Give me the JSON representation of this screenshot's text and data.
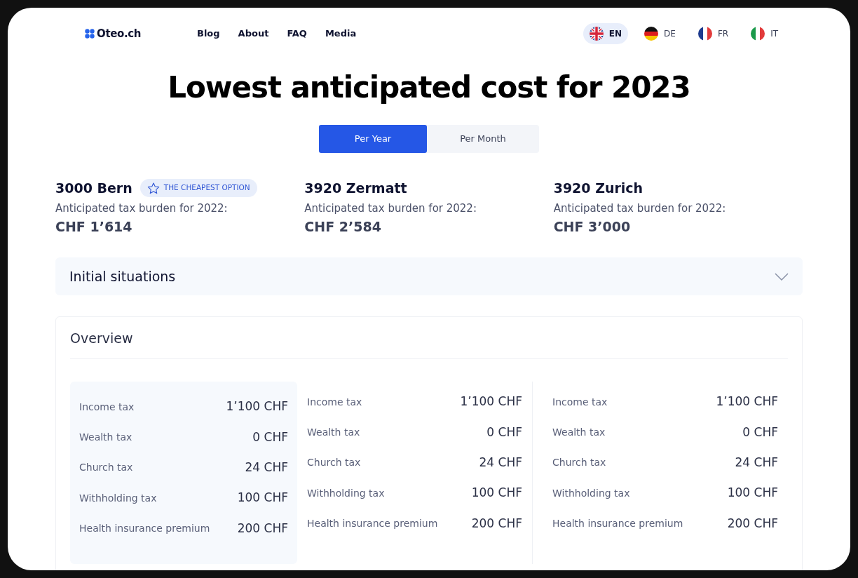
{
  "logo": "Oteo.ch",
  "nav": [
    "Blog",
    "About",
    "FAQ",
    "Media"
  ],
  "languages": [
    {
      "code": "EN",
      "selected": true
    },
    {
      "code": "DE",
      "selected": false
    },
    {
      "code": "FR",
      "selected": false
    },
    {
      "code": "IT",
      "selected": false
    }
  ],
  "heading": "Lowest anticipated cost for 2023",
  "tabs": [
    {
      "label": "Per Year",
      "selected": true
    },
    {
      "label": "Per Month",
      "selected": false
    }
  ],
  "cities": [
    {
      "name": "3000 Bern",
      "badge": "THE CHEAPEST OPTION",
      "caption": "Anticipated tax burden for 2022:",
      "amount": "CHF 1’614"
    },
    {
      "name": "3920 Zermatt",
      "caption": "Anticipated tax burden for 2022:",
      "amount": "CHF 2’584"
    },
    {
      "name": "3920 Zurich",
      "caption": "Anticipated tax burden for 2022:",
      "amount": "CHF 3’000"
    }
  ],
  "accordion": {
    "title": "Initial situations",
    "expanded": false
  },
  "overview": {
    "title": "Overview",
    "columns": [
      {
        "highlighted": true,
        "rows": [
          {
            "label": "Income tax",
            "value": "1’100 CHF"
          },
          {
            "label": "Wealth tax",
            "value": "0 CHF"
          },
          {
            "label": "Church tax",
            "value": "24 CHF"
          },
          {
            "label": "Withholding tax",
            "value": "100 CHF"
          },
          {
            "label": "Health insurance premium",
            "value": "200 CHF"
          }
        ]
      },
      {
        "highlighted": false,
        "rows": [
          {
            "label": "Income tax",
            "value": "1’100 CHF"
          },
          {
            "label": "Wealth tax",
            "value": "0 CHF"
          },
          {
            "label": "Church tax",
            "value": "24 CHF"
          },
          {
            "label": "Withholding tax",
            "value": "100 CHF"
          },
          {
            "label": "Health insurance premium",
            "value": "200 CHF"
          }
        ]
      },
      {
        "highlighted": false,
        "rows": [
          {
            "label": "Income tax",
            "value": "1’100 CHF"
          },
          {
            "label": "Wealth tax",
            "value": "0 CHF"
          },
          {
            "label": "Church tax",
            "value": "24 CHF"
          },
          {
            "label": "Withholding tax",
            "value": "100 CHF"
          },
          {
            "label": "Health insurance premium",
            "value": "200 CHF"
          }
        ]
      }
    ]
  }
}
